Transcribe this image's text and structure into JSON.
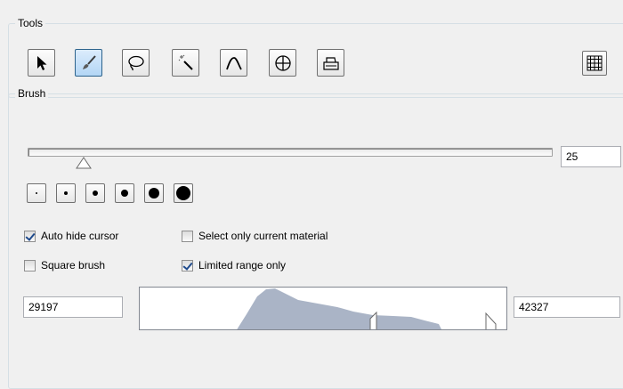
{
  "tools_group": {
    "title": "Tools",
    "buttons": [
      {
        "icon": "arrow-cursor-icon",
        "active": false
      },
      {
        "icon": "brush-icon",
        "active": true
      },
      {
        "icon": "lasso-icon",
        "active": false
      },
      {
        "icon": "magic-wand-icon",
        "active": false
      },
      {
        "icon": "curve-icon",
        "active": false
      },
      {
        "icon": "crosshair-icon",
        "active": false
      },
      {
        "icon": "printer-icon",
        "active": false
      }
    ],
    "grid_button_icon": "grid-icon"
  },
  "brush_group": {
    "title": "Brush",
    "size_value": "25",
    "size_presets": [
      "tiny",
      "small",
      "medium",
      "large",
      "larger",
      "largest"
    ],
    "auto_hide_cursor": {
      "label": "Auto hide cursor",
      "checked": true
    },
    "select_only_current_material": {
      "label": "Select only current material",
      "checked": false
    },
    "square_brush": {
      "label": "Square brush",
      "checked": false
    },
    "limited_range_only": {
      "label": "Limited range only",
      "checked": true
    },
    "range_min": "29197",
    "range_max": "42327"
  },
  "colors": {
    "histogram_fill": "#aab4c6",
    "active_button": "#b3d6f5"
  }
}
